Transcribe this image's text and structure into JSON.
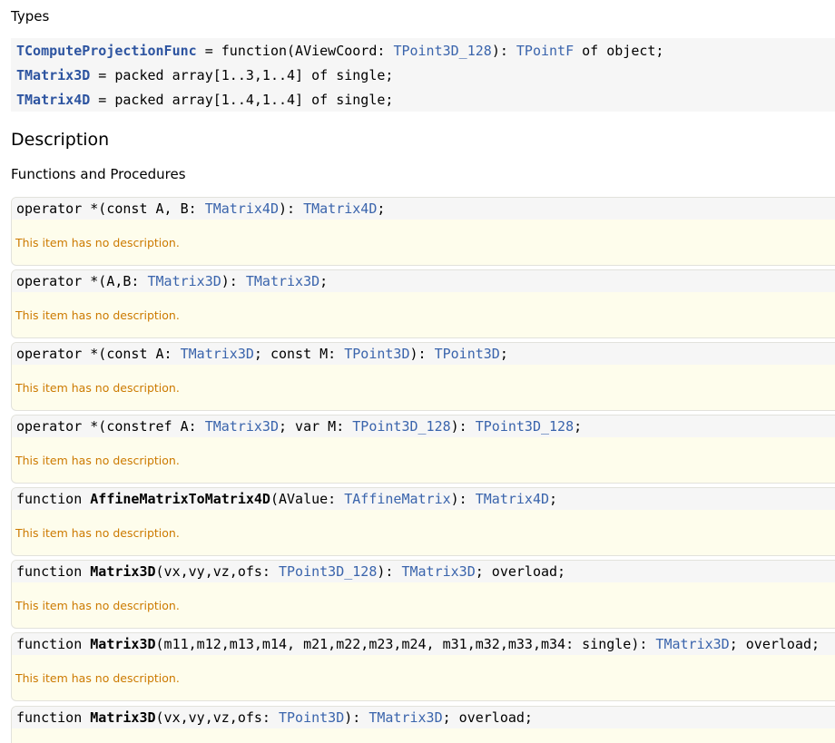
{
  "headings": {
    "types": "Types",
    "description": "Description",
    "functions": "Functions and Procedures"
  },
  "types": [
    {
      "name": "TComputeProjectionFunc",
      "t1": " = function(AViewCoord: ",
      "l1": "TPoint3D_128",
      "t2": "): ",
      "l2": "TPointF",
      "t3": " of object;"
    },
    {
      "name": "TMatrix3D",
      "t1": " = packed array[1..3,1..4] of single;"
    },
    {
      "name": "TMatrix4D",
      "t1": " = packed array[1..4,1..4] of single;"
    }
  ],
  "no_description": "This item has no description.",
  "items": [
    {
      "prefix": "operator *(const A, B: ",
      "l1": "TMatrix4D",
      "t1": "): ",
      "l2": "TMatrix4D",
      "t2": ";"
    },
    {
      "prefix": "operator *(A,B: ",
      "l1": "TMatrix3D",
      "t1": "): ",
      "l2": "TMatrix3D",
      "t2": ";"
    },
    {
      "prefix": "operator *(const A: ",
      "l1": "TMatrix3D",
      "t1": "; const M: ",
      "l2": "TPoint3D",
      "t2": "): ",
      "l3": "TPoint3D",
      "t3": ";"
    },
    {
      "prefix": "operator *(constref A: ",
      "l1": "TMatrix3D",
      "t1": "; var M: ",
      "l2": "TPoint3D_128",
      "t2": "): ",
      "l3": "TPoint3D_128",
      "t3": ";"
    },
    {
      "kw": "function ",
      "fname": "AffineMatrixToMatrix4D",
      "prefix": "(AValue: ",
      "l1": "TAffineMatrix",
      "t1": "): ",
      "l2": "TMatrix4D",
      "t2": ";"
    },
    {
      "kw": "function ",
      "fname": "Matrix3D",
      "prefix": "(vx,vy,vz,ofs: ",
      "l1": "TPoint3D_128",
      "t1": "): ",
      "l2": "TMatrix3D",
      "t2": "; overload;"
    },
    {
      "kw": "function ",
      "fname": "Matrix3D",
      "prefix": "(m11,m12,m13,m14, m21,m22,m23,m24, m31,m32,m33,m34: single): ",
      "l1": "TMatrix3D",
      "t1": "; overload;"
    },
    {
      "kw": "function ",
      "fname": "Matrix3D",
      "prefix": "(vx,vy,vz,ofs: ",
      "l1": "TPoint3D",
      "t1": "): ",
      "l2": "TMatrix3D",
      "t2": "; overload;"
    }
  ]
}
